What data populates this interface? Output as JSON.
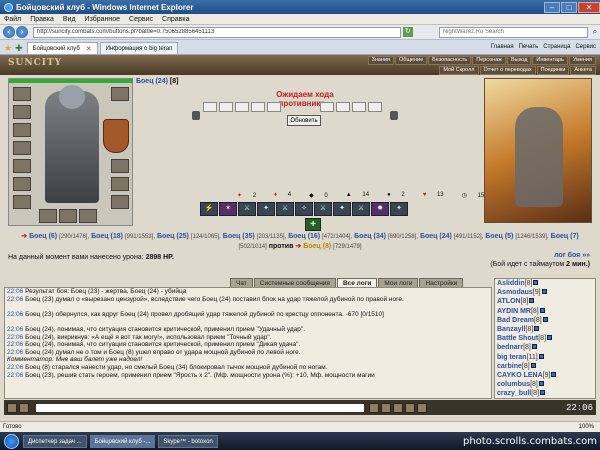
{
  "window": {
    "title": "Бойцовский клуб - Windows Internet Explorer"
  },
  "menu": [
    "Файл",
    "Правка",
    "Вид",
    "Избранное",
    "Сервис",
    "Справка"
  ],
  "address": {
    "url": "http://suncity.combats.com/buttons.pl?battle=0.7506528856451113",
    "search_placeholder": "NightWarez.Ru Search"
  },
  "tabs": [
    {
      "label": "Бойцовский клуб"
    },
    {
      "label": "Информация о big teran"
    }
  ],
  "toolbar": [
    "Главная",
    "Печать",
    "Страница",
    "Сервис"
  ],
  "game": {
    "logo": "SUNCITY",
    "nav": [
      "Знания",
      "Общение",
      "Безопасность",
      "Персонаж",
      "Выход",
      "Инвентарь",
      "Умения",
      "Мой Скролл",
      "Отчет о переводах",
      "Поединки",
      "Анкета"
    ],
    "fighter": {
      "name": "Боец",
      "level": "(24)",
      "suffix": "[8]"
    },
    "waiting": "Ожидаем хода противника...",
    "refresh": "Обновить",
    "stats": [
      "2",
      "4",
      "0",
      "14",
      "2",
      "13",
      "15"
    ],
    "fighters_line": {
      "items": [
        {
          "name": "Боец",
          "lvl": "(6)",
          "hp": "[290/1476],"
        },
        {
          "name": "Боец",
          "lvl": "(18)",
          "hp": "[991/1553],"
        },
        {
          "name": "Боец",
          "lvl": "(25)",
          "hp": "[124/1065],"
        },
        {
          "name": "Боец",
          "lvl": "(35)",
          "hp": "[203/1135],"
        },
        {
          "name": "Боец",
          "lvl": "(16)",
          "hp": "[472/1404],"
        },
        {
          "name": "Боец",
          "lvl": "(34)",
          "hp": "[690/1258],"
        },
        {
          "name": "Боец",
          "lvl": "(24)",
          "hp": "[491/1152],"
        },
        {
          "name": "Боец",
          "lvl": "(5)",
          "hp": "[1246/1539],"
        },
        {
          "name": "Боец",
          "lvl": "(7)",
          "hp": "[502/1014]"
        }
      ],
      "versus": "против",
      "enemy": {
        "name": "Боец",
        "lvl": "(8)",
        "hp": "[729/1479]"
      }
    },
    "log_link": "лог боя »»",
    "damage": {
      "text": "На данный момент вами нанесено урона:",
      "value": "2898 HP."
    },
    "timeout": {
      "text": "(Бой идет с таймаутом",
      "value": "2 мин.)"
    }
  },
  "chat": {
    "tabs": [
      "Чат",
      "Системные сообщения",
      "Все логи",
      "Мои логи",
      "Настройки"
    ],
    "messages": [
      {
        "time": "22:06",
        "text": "Результат боя: Боец (23) - жертва, Боец (24) - убийца"
      },
      {
        "time": "22:06",
        "text": "Боец (23) думал о «вырезано цензурой», вследствие чего Боец (24) поставил блок на удар тяжелой дубиной по правой ноге."
      },
      {
        "time": "22:06",
        "text": "Боец (23) обернулся, как вдруг Боец (24) провел дробящий удар тяжелой дубиной по крестцу оппонента. -670 [0/1510]"
      },
      {
        "time": "22:06",
        "text": "Боец (24), понимая, что ситуация становится критической, применил прием \"Удачный удар\"."
      },
      {
        "time": "22:06",
        "text": "Боец (24), викрикнув: «А ещё я вот так могу!», использовал прием \"Точный удар\"."
      },
      {
        "time": "22:06",
        "text": "Боец (24), понимая, что ситуация становится критической, применил прием \"Дикая удача\"."
      },
      {
        "time": "22:06",
        "text": "Боец (24) думал не о том и Боец (8) ушел вправо от удара мощной дубиной по левой ноге."
      },
      {
        "time": "",
        "text": "Комментатор: Мне ваш балет уже надоел!"
      },
      {
        "time": "22:06",
        "text": "Боец (8) старался нанести удар, но смелый Боец (34) блокировал тычок мощной дубиной по ногам."
      },
      {
        "time": "22:06",
        "text": "Боец (23), решив стать героем, применил прием \"Ярость x 2\". (Мф. мощности урона (%): +10, Мф. мощности магии"
      }
    ],
    "online": [
      {
        "name": "Asliddin",
        "lvl": "[8]"
      },
      {
        "name": "Asmodaus",
        "lvl": "[9]"
      },
      {
        "name": "ATLON",
        "lvl": "[8]"
      },
      {
        "name": "AYDIN MR",
        "lvl": "[8]"
      },
      {
        "name": "Bad Dream",
        "lvl": "[8]"
      },
      {
        "name": "Banzayll",
        "lvl": "[8]"
      },
      {
        "name": "Battle Shout",
        "lvl": "[8]"
      },
      {
        "name": "bednarr",
        "lvl": "[8]"
      },
      {
        "name": "big teran",
        "lvl": "[11]"
      },
      {
        "name": "carbine",
        "lvl": "[8]"
      },
      {
        "name": "CAYKO LENA",
        "lvl": "[9]"
      },
      {
        "name": "columbus",
        "lvl": "[8]"
      },
      {
        "name": "crazy_bull",
        "lvl": "[8]"
      }
    ],
    "clock": "22:06"
  },
  "statusbar": {
    "text": "Готово",
    "zoom": "100%"
  },
  "taskbar": {
    "items": [
      "Диспетчер задач ...",
      "Бойцовский клуб -...",
      "Skype™ - botoxon"
    ],
    "watermark": "photo.scrolls.combats.com"
  },
  "colors": {
    "accent": "#2c4fa0",
    "enemy": "#b8860b",
    "alert": "#c02020"
  }
}
